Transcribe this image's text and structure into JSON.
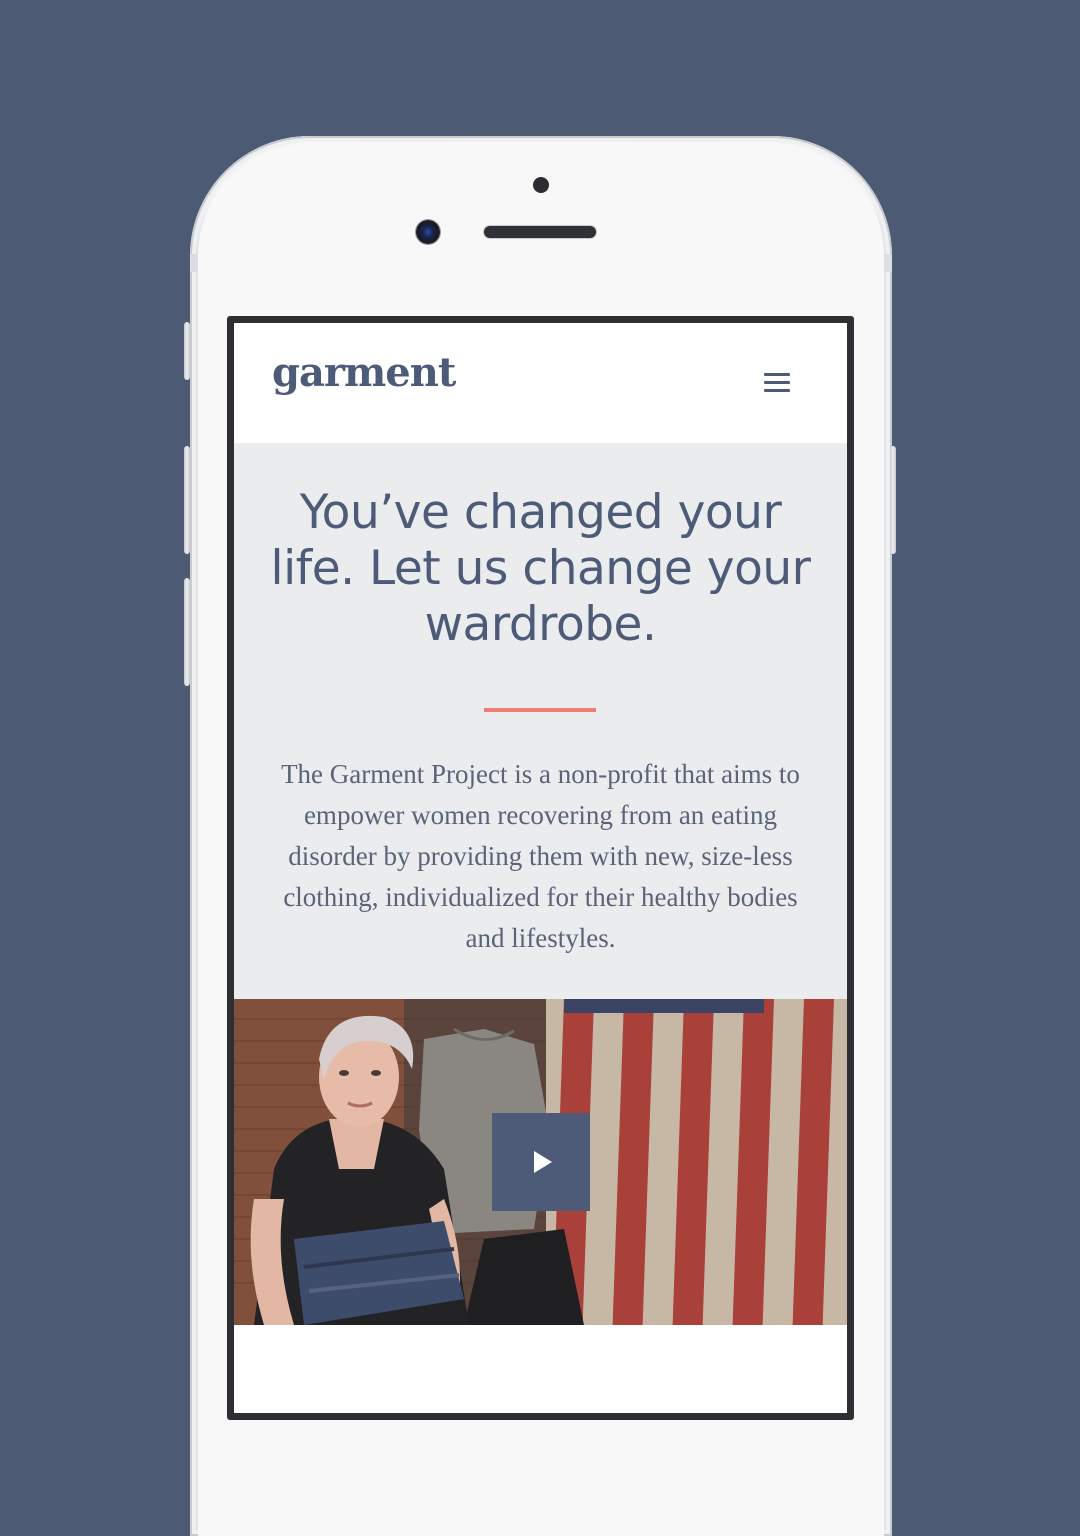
{
  "device": {
    "frame_color": "#f8f8f9",
    "background_color": "#4d5a73"
  },
  "site": {
    "logo_text": "garment",
    "menu_icon": "hamburger-menu-icon"
  },
  "hero": {
    "title": "You’ve changed your life. Let us change your wardrobe.",
    "description": "The Garment Project is a non-profit that aims to empower women recovering from an eating disorder by providing them with new, size-less clothing, individualized for their healthy bodies and lifestyles.",
    "accent_color": "#ef7d74",
    "text_color": "#4e5b78",
    "background_color": "#ebecee"
  },
  "video": {
    "play_icon": "play-icon",
    "button_color": "#4e5b78"
  }
}
